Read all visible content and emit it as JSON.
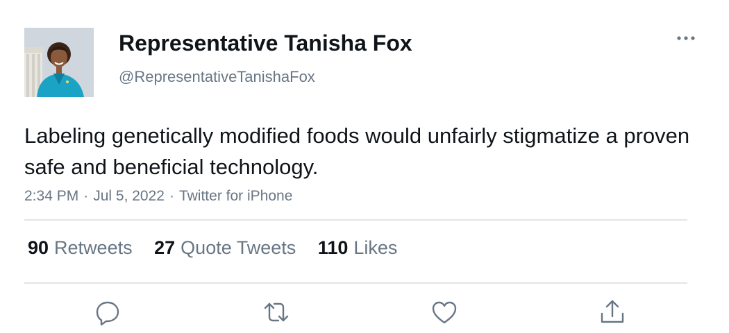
{
  "author": {
    "display_name": "Representative Tanisha Fox",
    "handle": "@RepresentativeTanishaFox"
  },
  "tweet": {
    "text": "Labeling genetically modified foods would unfairly stigmatize a proven safe and beneficial technology.",
    "time": "2:34 PM",
    "date": "Jul 5, 2022",
    "source": "Twitter for iPhone",
    "separator": "·"
  },
  "stats": {
    "retweets": {
      "count": "90",
      "label": "Retweets"
    },
    "quote_tweets": {
      "count": "27",
      "label": "Quote Tweets"
    },
    "likes": {
      "count": "110",
      "label": "Likes"
    }
  },
  "icons": {
    "more": "more-horizontal-icon",
    "reply": "reply-icon",
    "retweet": "retweet-icon",
    "like": "heart-icon",
    "share": "share-icon"
  },
  "colors": {
    "text_primary": "#0f1419",
    "text_secondary": "#687684",
    "divider": "#e1e5e8"
  }
}
